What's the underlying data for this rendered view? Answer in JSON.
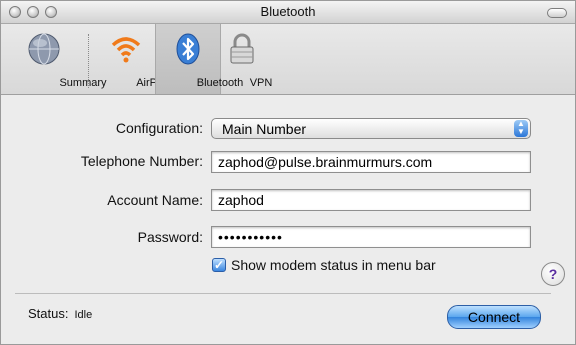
{
  "window": {
    "title": "Bluetooth"
  },
  "toolbar": {
    "items": [
      {
        "label": "Summary",
        "icon": "network-globe-icon",
        "selected": false
      },
      {
        "label": "AirPort",
        "icon": "airport-icon",
        "selected": false
      },
      {
        "label": "Bluetooth",
        "icon": "bluetooth-icon",
        "selected": true
      },
      {
        "label": "VPN",
        "icon": "vpn-lock-icon",
        "selected": false
      }
    ]
  },
  "form": {
    "configuration_label": "Configuration:",
    "configuration_value": "Main Number",
    "telephone_label": "Telephone Number:",
    "telephone_value": "zaphod@pulse.brainmurmurs.com",
    "account_label": "Account Name:",
    "account_value": "zaphod",
    "password_label": "Password:",
    "password_value": "•••••••••••",
    "checkbox_label": "Show modem status in menu bar",
    "checkbox_checked": true
  },
  "footer": {
    "status_label": "Status:",
    "status_value": "Idle",
    "connect_label": "Connect",
    "help_label": "?"
  },
  "colors": {
    "accent": "#3a86e0",
    "airport": "#f07a1a"
  }
}
